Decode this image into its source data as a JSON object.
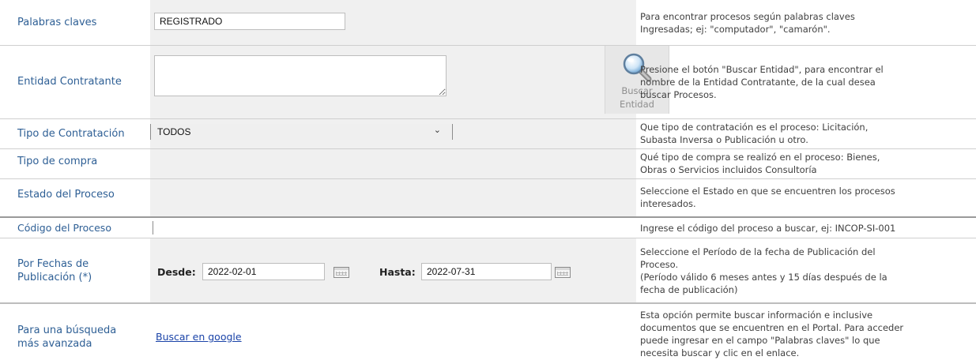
{
  "rows": {
    "keywords": {
      "label": "Palabras claves",
      "value": "REGISTRADO",
      "help": "Para encontrar procesos según palabras claves\nIngresadas; ej: \"computador\", \"camarón\"."
    },
    "entity": {
      "label": "Entidad Contratante",
      "value": "",
      "button_label": "Buscar\nEntidad",
      "help": "Presione el botón \"Buscar Entidad\", para encontrar el\nnombre de la Entidad Contratante, de la cual desea\nbuscar Procesos."
    },
    "contract_type": {
      "label": "Tipo de Contratación",
      "selected": "TODOS",
      "help": "Que tipo de contratación es el proceso: Licitación,\nSubasta Inversa o Publicación u otro."
    },
    "purchase_type": {
      "label": "Tipo de compra",
      "help": "Qué tipo de compra se realizó en el proceso: Bienes,\nObras o Servicios incluidos Consultoría"
    },
    "process_state": {
      "label": "Estado del Proceso",
      "help": "Seleccione el Estado en que se encuentren los procesos\ninteresados."
    },
    "process_code": {
      "label": "Código del Proceso",
      "value": "",
      "help": "Ingrese el código del proceso a buscar, ej: INCOP-SI-001"
    },
    "dates": {
      "label": "Por Fechas de\nPublicación (*)",
      "from_label": "Desde:",
      "from_value": "2022-02-01",
      "to_label": "Hasta:",
      "to_value": "2022-07-31",
      "help": "Seleccione el Período de la fecha de Publicación del\nProceso.\n(Período válido 6 meses antes y 15 días después de la\nfecha de publicación)"
    },
    "advanced": {
      "label": "Para una búsqueda\nmás avanzada",
      "link": "Buscar en google",
      "help": "Esta opción permite buscar información e inclusive\ndocumentos que se encuentren en el Portal. Para acceder\npuede ingresar en el campo \"Palabras claves\" lo que\nnecesita buscar y clic en el enlace."
    }
  }
}
